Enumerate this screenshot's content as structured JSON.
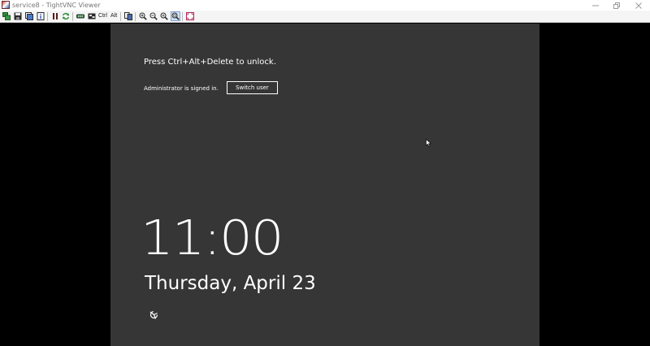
{
  "window": {
    "title": "service8 - TightVNC Viewer",
    "app_icon": "tightvnc-icon",
    "controls": [
      "minimize-icon",
      "restore-icon",
      "close-icon"
    ]
  },
  "toolbar": {
    "buttons": [
      {
        "name": "new-connection-icon"
      },
      {
        "name": "save-connection-icon"
      },
      {
        "name": "options-icon"
      },
      {
        "name": "connection-info-icon"
      },
      {
        "name": "pause-icon"
      },
      {
        "name": "refresh-icon"
      },
      {
        "name": "send-ctrl-alt-del-icon"
      },
      {
        "name": "send-ctrl-esc-icon"
      },
      {
        "name": "ctrl-key",
        "label": "Ctrl"
      },
      {
        "name": "alt-key",
        "label": "Alt"
      },
      {
        "name": "transfer-files-icon"
      },
      {
        "name": "zoom-in-icon"
      },
      {
        "name": "zoom-out-icon"
      },
      {
        "name": "zoom-100-icon"
      },
      {
        "name": "zoom-auto-icon",
        "active": true
      },
      {
        "name": "full-screen-icon"
      }
    ]
  },
  "lockscreen": {
    "unlock_hint": "Press Ctrl+Alt+Delete to unlock.",
    "signed_in_text": "Administrator is signed in.",
    "switch_user_label": "Switch user",
    "time": "11:00",
    "date": "Thursday, April 23",
    "ease_of_access_icon": "ease-of-access-icon",
    "background_color": "#363636"
  }
}
